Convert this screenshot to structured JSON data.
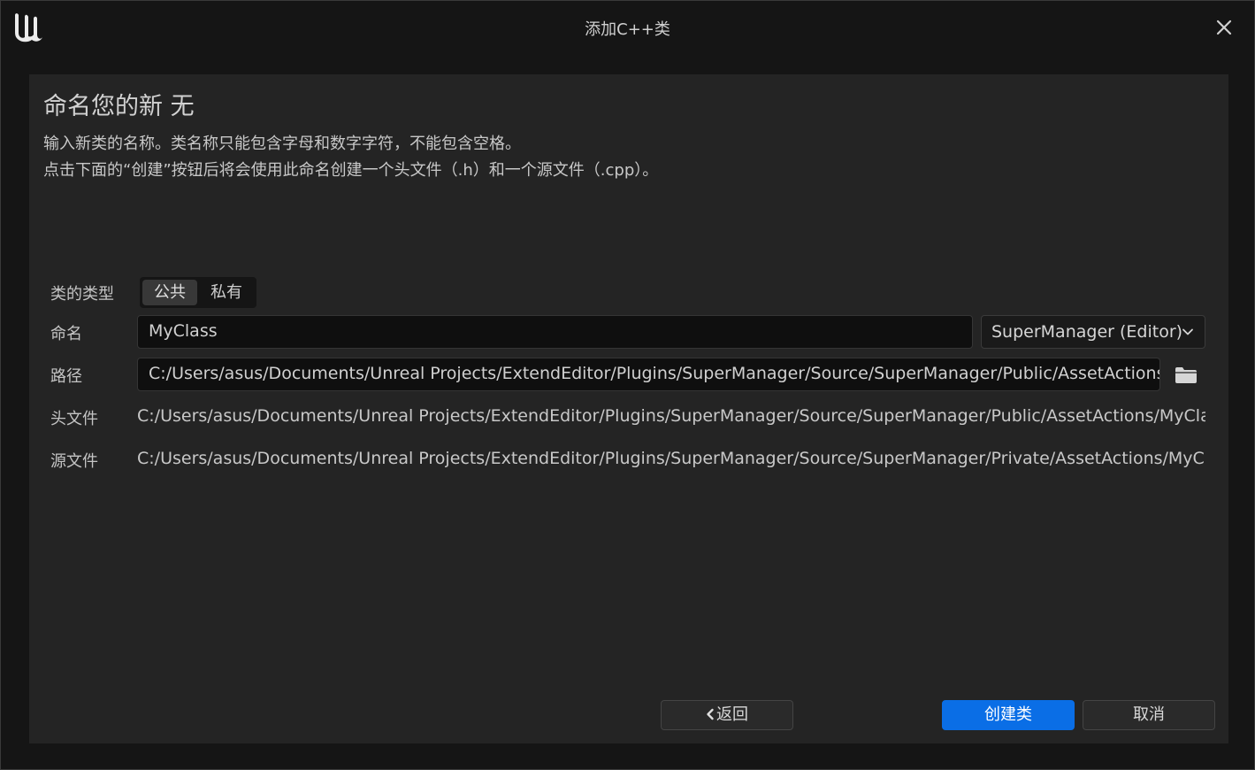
{
  "window": {
    "title": "添加C++类",
    "logo_icon": "unreal-engine-logo",
    "close_icon": "close-icon"
  },
  "header": {
    "heading": "命名您的新 无",
    "description_line1": "输入新类的名称。类名称只能包含字母和数字字符，不能包含空格。",
    "description_line2": "点击下面的“创建”按钮后将会使用此命名创建一个头文件（.h）和一个源文件（.cpp）。"
  },
  "form": {
    "class_type_label": "类的类型",
    "class_type_options": [
      "公共",
      "私有"
    ],
    "class_type_selected": "公共",
    "name_label": "命名",
    "name_value": "MyClass",
    "module_value": "SuperManager (Editor)",
    "path_label": "路径",
    "path_value": "C:/Users/asus/Documents/Unreal Projects/ExtendEditor/Plugins/SuperManager/Source/SuperManager/Public/AssetActions",
    "header_file_label": "头文件",
    "header_file_value": "C:/Users/asus/Documents/Unreal Projects/ExtendEditor/Plugins/SuperManager/Source/SuperManager/Public/AssetActions/MyClass.h",
    "source_file_label": "源文件",
    "source_file_value": "C:/Users/asus/Documents/Unreal Projects/ExtendEditor/Plugins/SuperManager/Source/SuperManager/Private/AssetActions/MyClass.cpp"
  },
  "footer": {
    "back_label": "返回",
    "create_label": "创建类",
    "cancel_label": "取消"
  },
  "colors": {
    "background": "#151515",
    "panel": "#242424",
    "accent": "#0a6ee6"
  }
}
